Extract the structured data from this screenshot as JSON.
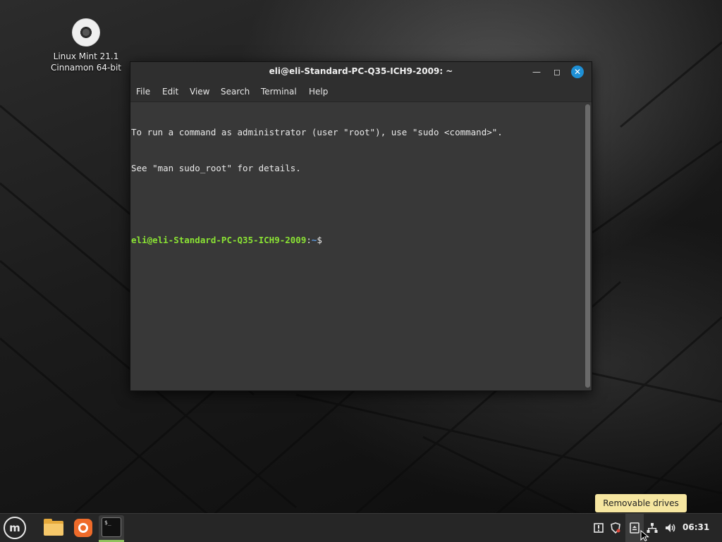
{
  "desktop": {
    "icon_label": "Linux Mint 21.1\nCinnamon 64-bit"
  },
  "terminal": {
    "title": "eli@eli-Standard-PC-Q35-ICH9-2009: ~",
    "menu": [
      "File",
      "Edit",
      "View",
      "Search",
      "Terminal",
      "Help"
    ],
    "lines": [
      "To run a command as administrator (user \"root\"), use \"sudo <command>\".",
      "See \"man sudo_root\" for details."
    ],
    "prompt_user": "eli@eli-Standard-PC-Q35-ICH9-2009",
    "prompt_sep": ":",
    "prompt_path": "~",
    "prompt_symbol": "$"
  },
  "tooltip": "Removable drives",
  "panel": {
    "apps": [
      "files-icon",
      "firefox-icon",
      "terminal-icon"
    ],
    "terminal_icon_text": "$_",
    "tray_icons": [
      "update-manager-icon",
      "shield-icon",
      "removable-drives-icon",
      "network-icon",
      "volume-icon"
    ],
    "clock": "06:31"
  },
  "colors": {
    "prompt_user": "#8ae234",
    "prompt_path": "#5c9de6",
    "close_button": "#1e90d6",
    "tooltip_bg": "#f6e6a0",
    "active_indicator": "#8fc15d"
  }
}
